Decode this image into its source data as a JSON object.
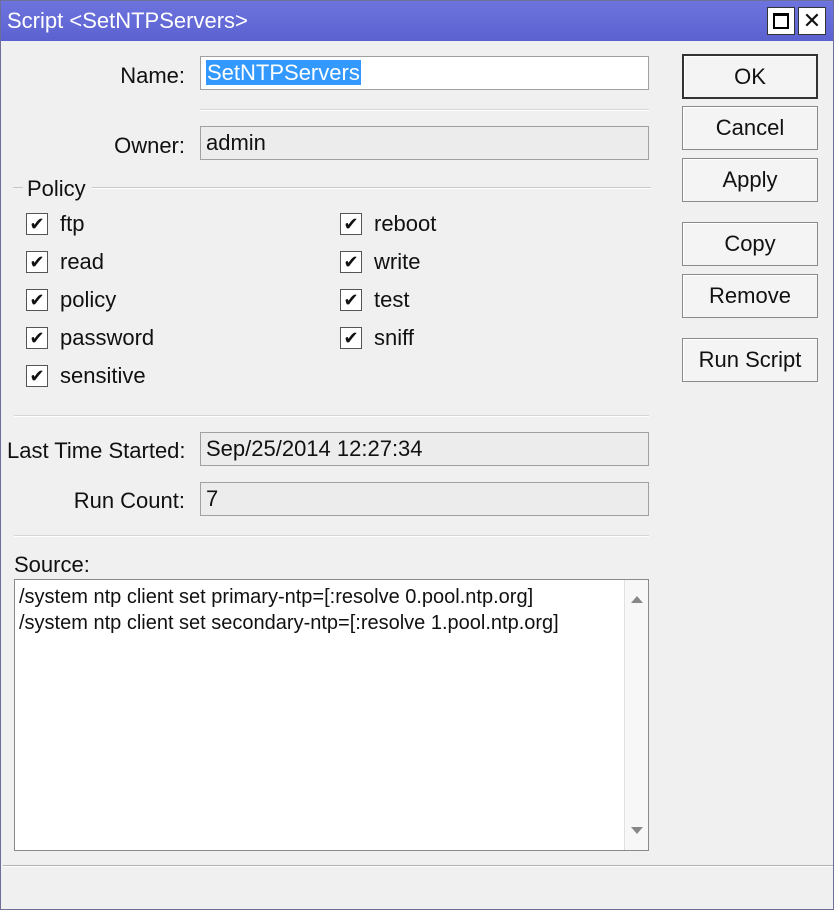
{
  "window": {
    "title": "Script <SetNTPServers>",
    "maximize_icon": "maximize-icon",
    "close_icon": "close-icon",
    "close_glyph": "✕"
  },
  "form": {
    "name_label": "Name:",
    "name_value": "SetNTPServers",
    "owner_label": "Owner:",
    "owner_value": "admin",
    "last_started_label": "Last Time Started:",
    "last_started_value": "Sep/25/2014 12:27:34",
    "run_count_label": "Run Count:",
    "run_count_value": "7",
    "source_label": "Source:"
  },
  "policy": {
    "title": "Policy",
    "left": [
      {
        "label": "ftp",
        "checked": true
      },
      {
        "label": "read",
        "checked": true
      },
      {
        "label": "policy",
        "checked": true
      },
      {
        "label": "password",
        "checked": true
      },
      {
        "label": "sensitive",
        "checked": true
      }
    ],
    "right": [
      {
        "label": "reboot",
        "checked": true
      },
      {
        "label": "write",
        "checked": true
      },
      {
        "label": "test",
        "checked": true
      },
      {
        "label": "sniff",
        "checked": true
      }
    ],
    "check_glyph": "✔"
  },
  "buttons": {
    "ok": "OK",
    "cancel": "Cancel",
    "apply": "Apply",
    "copy": "Copy",
    "remove": "Remove",
    "run_script": "Run Script"
  },
  "source": {
    "text": "/system ntp client set primary-ntp=[:resolve 0.pool.ntp.org]\n/system ntp client set secondary-ntp=[:resolve 1.pool.ntp.org]"
  },
  "colors": {
    "titlebar": "#6a6fd8",
    "selection": "#3399ff"
  }
}
